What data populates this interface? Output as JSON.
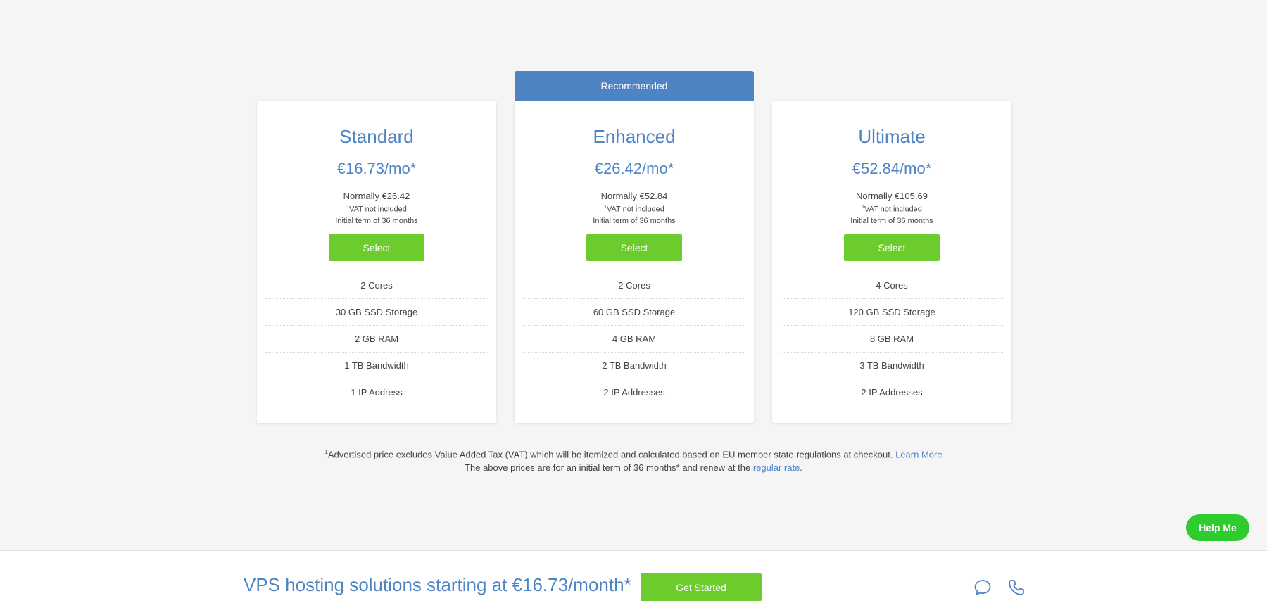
{
  "plans": [
    {
      "name": "Standard",
      "price": "€16.73/mo*",
      "normally_label": "Normally",
      "normal_price": "€26.42",
      "vat_mark": "1",
      "vat_note": "VAT not included",
      "term_note": "Initial term of 36 months",
      "select_label": "Select",
      "features": [
        "2 Cores",
        "30 GB SSD Storage",
        "2 GB RAM",
        "1 TB Bandwidth",
        "1 IP Address"
      ]
    },
    {
      "name": "Enhanced",
      "recommended_label": "Recommended",
      "price": "€26.42/mo*",
      "normally_label": "Normally",
      "normal_price": "€52.84",
      "vat_mark": "1",
      "vat_note": "VAT not included",
      "term_note": "Initial term of 36 months",
      "select_label": "Select",
      "features": [
        "2 Cores",
        "60 GB SSD Storage",
        "4 GB RAM",
        "2 TB Bandwidth",
        "2 IP Addresses"
      ]
    },
    {
      "name": "Ultimate",
      "price": "€52.84/mo*",
      "normally_label": "Normally",
      "normal_price": "€105.69",
      "vat_mark": "1",
      "vat_note": "VAT not included",
      "term_note": "Initial term of 36 months",
      "select_label": "Select",
      "features": [
        "4 Cores",
        "120 GB SSD Storage",
        "8 GB RAM",
        "3 TB Bandwidth",
        "2 IP Addresses"
      ]
    }
  ],
  "footnote": {
    "mark": "1",
    "line1": "Advertised price excludes Value Added Tax (VAT) which will be itemized and calculated based on EU member state regulations at checkout.",
    "learn_more": "Learn More",
    "line2_prefix": "The above prices are for an initial term of 36 months* and renew at the",
    "regular_rate": "regular rate",
    "line2_suffix": "."
  },
  "help_button": "Help Me",
  "bottom_bar": {
    "headline": "VPS hosting solutions starting at €16.73/month*",
    "cta_label": "Get Started",
    "icons": [
      "chat-icon",
      "phone-icon"
    ]
  },
  "colors": {
    "accent_blue": "#4f84c4",
    "cta_green": "#6ccb2d",
    "help_green": "#2ecc2e",
    "background": "#f5f5f5"
  }
}
